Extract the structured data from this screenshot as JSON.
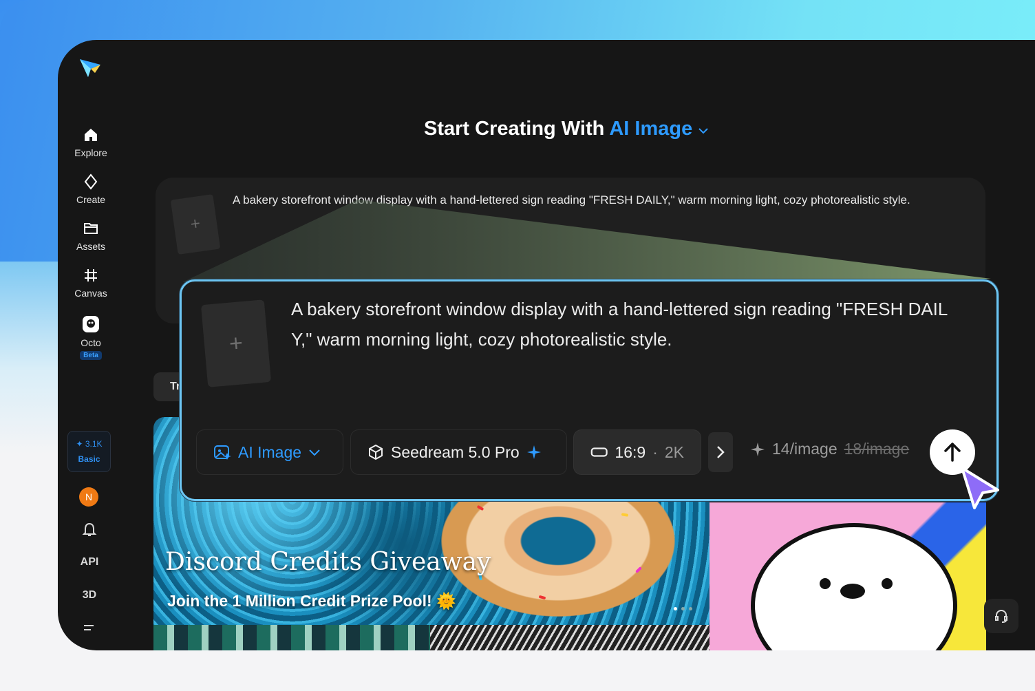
{
  "nav": {
    "explore": "Explore",
    "create": "Create",
    "assets": "Assets",
    "canvas": "Canvas",
    "octo": "Octo",
    "octo_badge": "Beta",
    "credits": "✦ 3.1K",
    "plan": "Basic",
    "avatar_initial": "N",
    "api": "API",
    "three_d": "3D"
  },
  "header": {
    "title_prefix": "Start Creating With",
    "title_accent": "AI Image"
  },
  "prompt_small": "A bakery storefront window display with a hand-lettered sign reading \"FRESH DAILY,\" warm morning light, cozy photorealistic style.",
  "prompt_zoom_line1": "A bakery storefront window display with a hand-lettered sign reading \"FRESH DAIL",
  "prompt_zoom_line2": "Y,\" warm morning light, cozy photorealistic style.",
  "upload_plus": "+",
  "toolbar": {
    "mode": "AI Image",
    "model": "Seedream 5.0 Pro",
    "ratio": "16:9",
    "quality": "2K",
    "price": "14/image",
    "price_old": "18/image"
  },
  "tab_partial": "Tr",
  "banner": {
    "title": "Discord Credits Giveaway",
    "subtitle": "Join the 1 Million Credit Prize Pool!",
    "emoji": "🌞"
  },
  "colors": {
    "accent": "#2e9bff",
    "card_border": "#6cc5f2",
    "avatar": "#f07a14",
    "cursor": "#8e6cf7"
  }
}
